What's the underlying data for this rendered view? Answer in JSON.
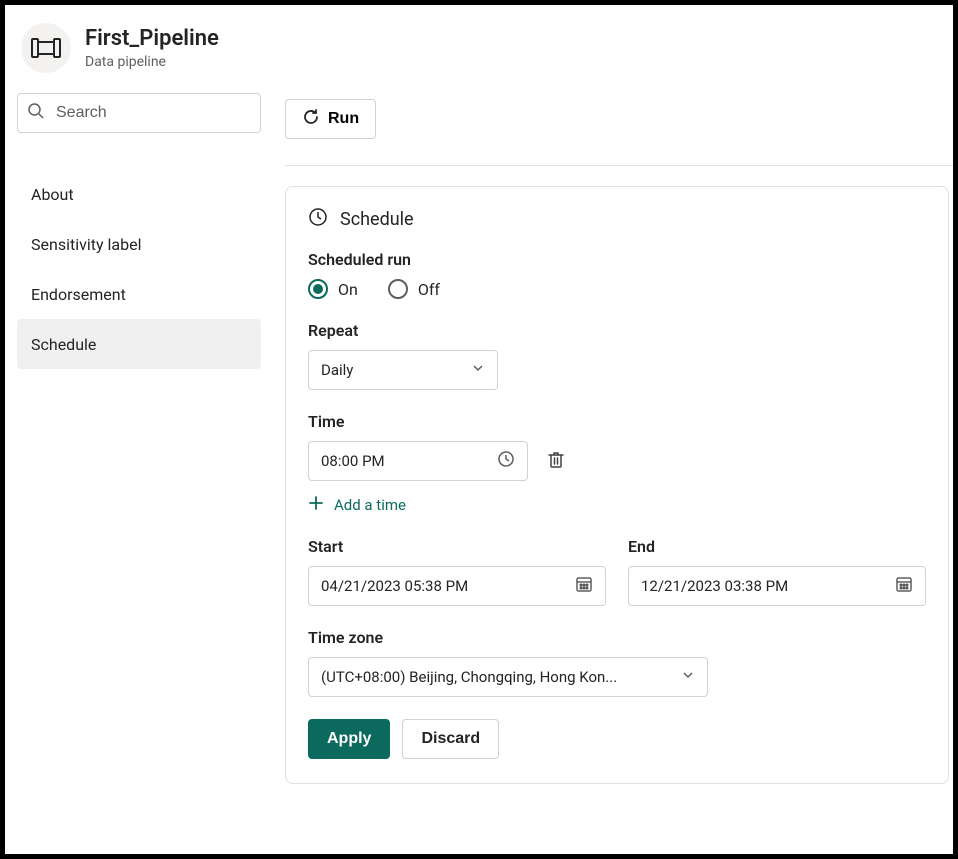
{
  "title": "First_Pipeline",
  "subtitle": "Data pipeline",
  "search": {
    "placeholder": "Search"
  },
  "sidebar": {
    "items": [
      {
        "label": "About",
        "selected": false
      },
      {
        "label": "Sensitivity label",
        "selected": false
      },
      {
        "label": "Endorsement",
        "selected": false
      },
      {
        "label": "Schedule",
        "selected": true
      }
    ]
  },
  "run_button": "Run",
  "panel": {
    "title": "Schedule",
    "scheduled_run": {
      "label": "Scheduled run",
      "options": {
        "on": "On",
        "off": "Off"
      },
      "value": "on"
    },
    "repeat": {
      "label": "Repeat",
      "value": "Daily"
    },
    "time": {
      "label": "Time",
      "values": [
        "08:00 PM"
      ],
      "add_label": "Add a time"
    },
    "start": {
      "label": "Start",
      "value": "04/21/2023 05:38 PM"
    },
    "end": {
      "label": "End",
      "value": "12/21/2023 03:38 PM"
    },
    "timezone": {
      "label": "Time zone",
      "value": "(UTC+08:00) Beijing, Chongqing, Hong Kon..."
    },
    "buttons": {
      "apply": "Apply",
      "discard": "Discard"
    }
  }
}
